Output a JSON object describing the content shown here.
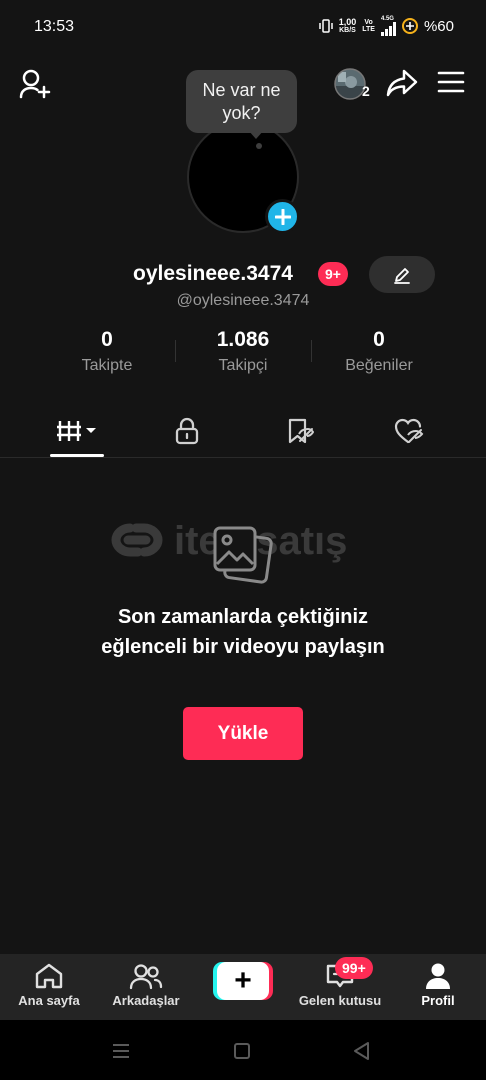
{
  "status_bar": {
    "time": "13:53",
    "net_speed_top": "1,00",
    "net_speed_bottom": "KB/S",
    "volte_top": "Vo",
    "volte_bottom": "LTE",
    "network_type": "4.5G",
    "battery": "%60"
  },
  "top_bar": {
    "story_count": "2"
  },
  "profile": {
    "note_bubble": "Ne var ne yok?",
    "username": "oylesineee.3474",
    "username_badge": "9+",
    "handle": "@oylesineee.3474"
  },
  "stats": [
    {
      "value": "0",
      "label": "Takipte"
    },
    {
      "value": "1.086",
      "label": "Takipçi"
    },
    {
      "value": "0",
      "label": "Beğeniler"
    }
  ],
  "tabs": [
    {
      "name": "videos-grid",
      "icon": "grid-icon",
      "active": true
    },
    {
      "name": "private",
      "icon": "lock-icon",
      "active": false
    },
    {
      "name": "favorites",
      "icon": "bookmark-hidden-icon",
      "active": false
    },
    {
      "name": "liked",
      "icon": "heart-hidden-icon",
      "active": false
    }
  ],
  "watermark": "itemsatış",
  "empty_state": {
    "message": "Son zamanlarda çektiğiniz eğlenceli bir videoyu paylaşın",
    "button": "Yükle"
  },
  "bottom_nav": {
    "home": "Ana sayfa",
    "friends": "Arkadaşlar",
    "create": "+",
    "inbox": "Gelen kutusu",
    "inbox_badge": "99+",
    "profile": "Profil"
  },
  "colors": {
    "accent": "#fe2c55",
    "cyan": "#25f4ee",
    "plus_blue": "#20b5e8",
    "background": "#141414"
  }
}
